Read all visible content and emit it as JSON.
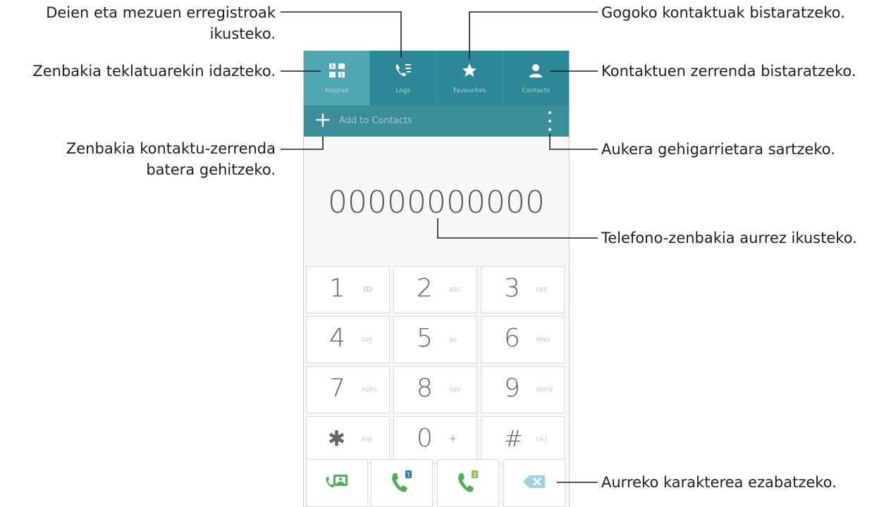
{
  "tabs": [
    {
      "label": "Keypad",
      "icon": "dialpad-grid-icon"
    },
    {
      "label": "Logs",
      "icon": "call-log-icon"
    },
    {
      "label": "Favourites",
      "icon": "star-icon"
    },
    {
      "label": "Contacts",
      "icon": "person-icon"
    }
  ],
  "actionbar": {
    "add_label": "Add to Contacts",
    "more_icon": "more-vert-icon"
  },
  "display": {
    "number": "00000000000"
  },
  "keys": [
    {
      "digit": "1",
      "sub": "ꝏ"
    },
    {
      "digit": "2",
      "sub": "ABC"
    },
    {
      "digit": "3",
      "sub": "DEF"
    },
    {
      "digit": "4",
      "sub": "GHI"
    },
    {
      "digit": "5",
      "sub": "JKL"
    },
    {
      "digit": "6",
      "sub": "MNO"
    },
    {
      "digit": "7",
      "sub": "PQRS"
    },
    {
      "digit": "8",
      "sub": "TUV"
    },
    {
      "digit": "9",
      "sub": "WXYZ"
    },
    {
      "digit": "✱",
      "sub": "P/W"
    },
    {
      "digit": "0",
      "sub": "+"
    },
    {
      "digit": "#",
      "sub": "[✕]"
    }
  ],
  "call_buttons": [
    {
      "icon": "video-call-icon"
    },
    {
      "icon": "call-sim1-icon",
      "badge": "1"
    },
    {
      "icon": "call-sim2-icon",
      "badge": "2"
    },
    {
      "icon": "backspace-icon"
    }
  ],
  "annotations": {
    "logs_line1": "Deien eta mezuen erregistroak",
    "logs_line2": "ikusteko.",
    "keypad": "Zenbakia teklatuarekin idazteko.",
    "add_line1": "Zenbakia kontaktu-zerrenda",
    "add_line2": "batera gehitzeko.",
    "favourites": "Gogoko kontaktuak bistaratzeko.",
    "contacts": "Kontaktuen zerrenda bistaratzeko.",
    "more": "Aukera gehigarrietara sartzeko.",
    "preview": "Telefono-zenbakia aurrez ikusteko.",
    "delete": "Aurreko karakterea ezabatzeko."
  },
  "colors": {
    "tab_bar": "#2c8796",
    "tab_active": "#4fa5b1",
    "action_bar": "#3b8d99",
    "call_green": "#4caf50",
    "backspace": "#62b8c6"
  }
}
